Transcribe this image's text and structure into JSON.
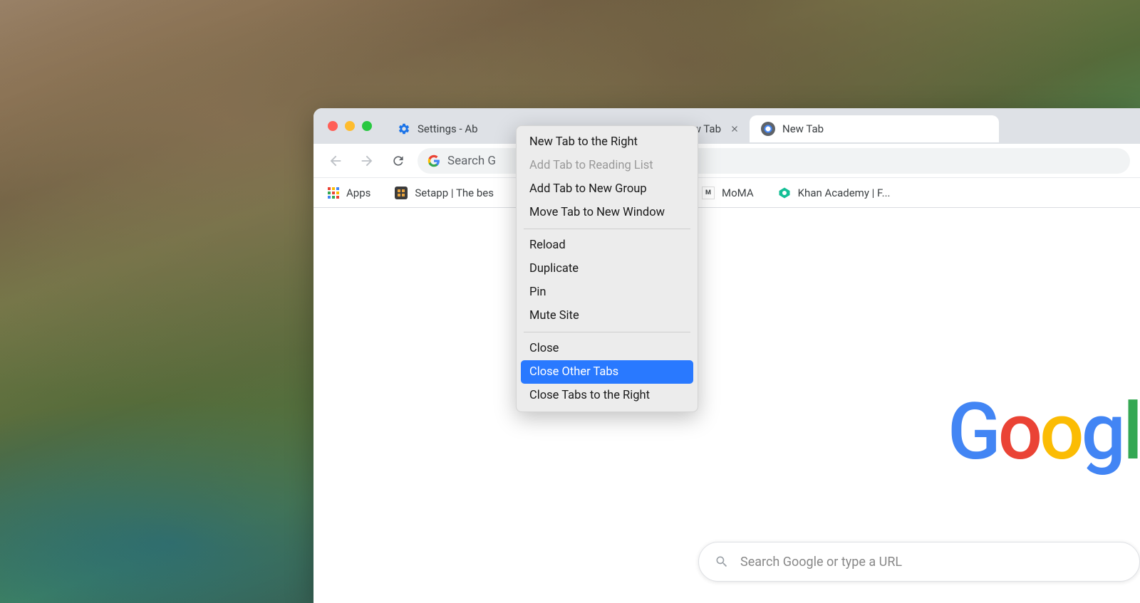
{
  "tabs": [
    {
      "label": "Settings - Ab",
      "icon": "gear"
    },
    {
      "label": "w Tab",
      "icon": null
    },
    {
      "label": "New Tab",
      "icon": "chrome"
    }
  ],
  "omnibox": {
    "placeholder": "Search G"
  },
  "bookmarks": [
    {
      "label": "Apps",
      "icon": "apps"
    },
    {
      "label": "Setapp | The bes",
      "icon": "setapp"
    },
    {
      "label": "MoMA",
      "icon": "moma"
    },
    {
      "label": "Khan Academy | F...",
      "icon": "khan"
    }
  ],
  "logo_text": "Googl",
  "search": {
    "placeholder": "Search Google or type a URL"
  },
  "context_menu": {
    "groups": [
      [
        {
          "label": "New Tab to the Right",
          "enabled": true
        },
        {
          "label": "Add Tab to Reading List",
          "enabled": false
        },
        {
          "label": "Add Tab to New Group",
          "enabled": true
        },
        {
          "label": "Move Tab to New Window",
          "enabled": true
        }
      ],
      [
        {
          "label": "Reload",
          "enabled": true
        },
        {
          "label": "Duplicate",
          "enabled": true
        },
        {
          "label": "Pin",
          "enabled": true
        },
        {
          "label": "Mute Site",
          "enabled": true
        }
      ],
      [
        {
          "label": "Close",
          "enabled": true
        },
        {
          "label": "Close Other Tabs",
          "enabled": true,
          "highlighted": true
        },
        {
          "label": "Close Tabs to the Right",
          "enabled": true
        }
      ]
    ]
  }
}
